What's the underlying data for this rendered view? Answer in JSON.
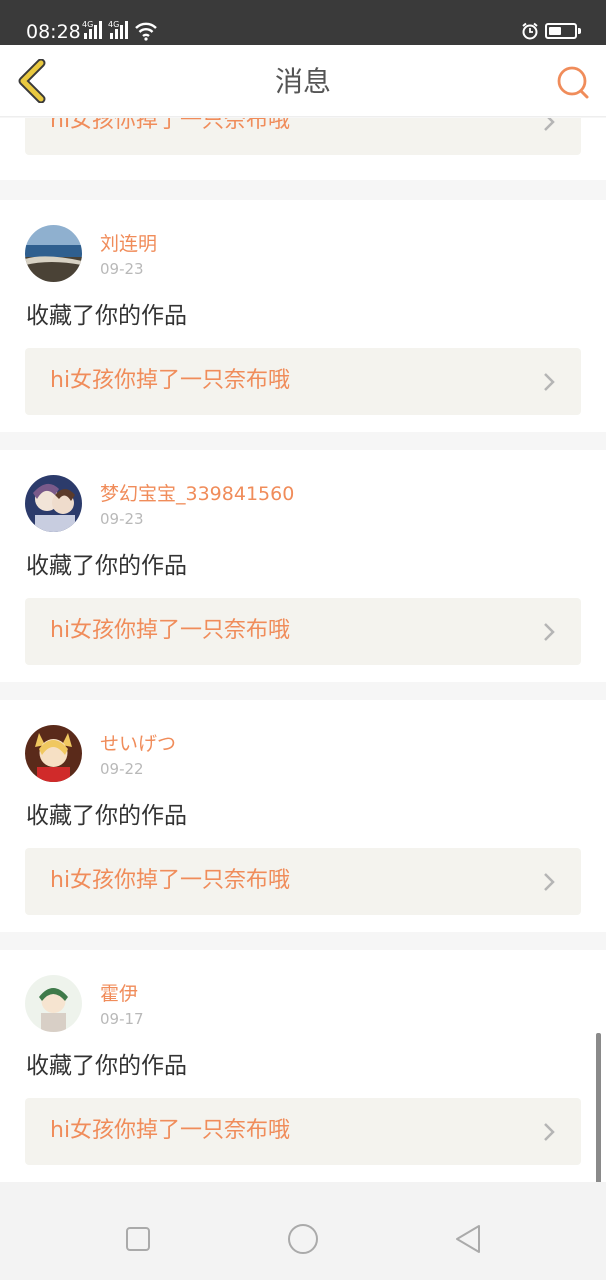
{
  "status_bar": {
    "time": "08:28",
    "network_tag_1": "4G",
    "network_tag_2": "4G"
  },
  "header": {
    "title": "消息"
  },
  "colors": {
    "accent": "#f08c5a",
    "back_icon": "#e9c940",
    "text": "#333333"
  },
  "notifications": [
    {
      "work_title": "hi女孩你掉了一只奈布哦"
    },
    {
      "username": "刘连明",
      "date": "09-23",
      "action": "收藏了你的作品",
      "work_title": "hi女孩你掉了一只奈布哦"
    },
    {
      "username": "梦幻宝宝_339841560",
      "date": "09-23",
      "action": "收藏了你的作品",
      "work_title": "hi女孩你掉了一只奈布哦"
    },
    {
      "username": "せいげつ",
      "date": "09-22",
      "action": "收藏了你的作品",
      "work_title": "hi女孩你掉了一只奈布哦"
    },
    {
      "username": "霍伊",
      "date": "09-17",
      "action": "收藏了你的作品",
      "work_title": "hi女孩你掉了一只奈布哦"
    }
  ]
}
